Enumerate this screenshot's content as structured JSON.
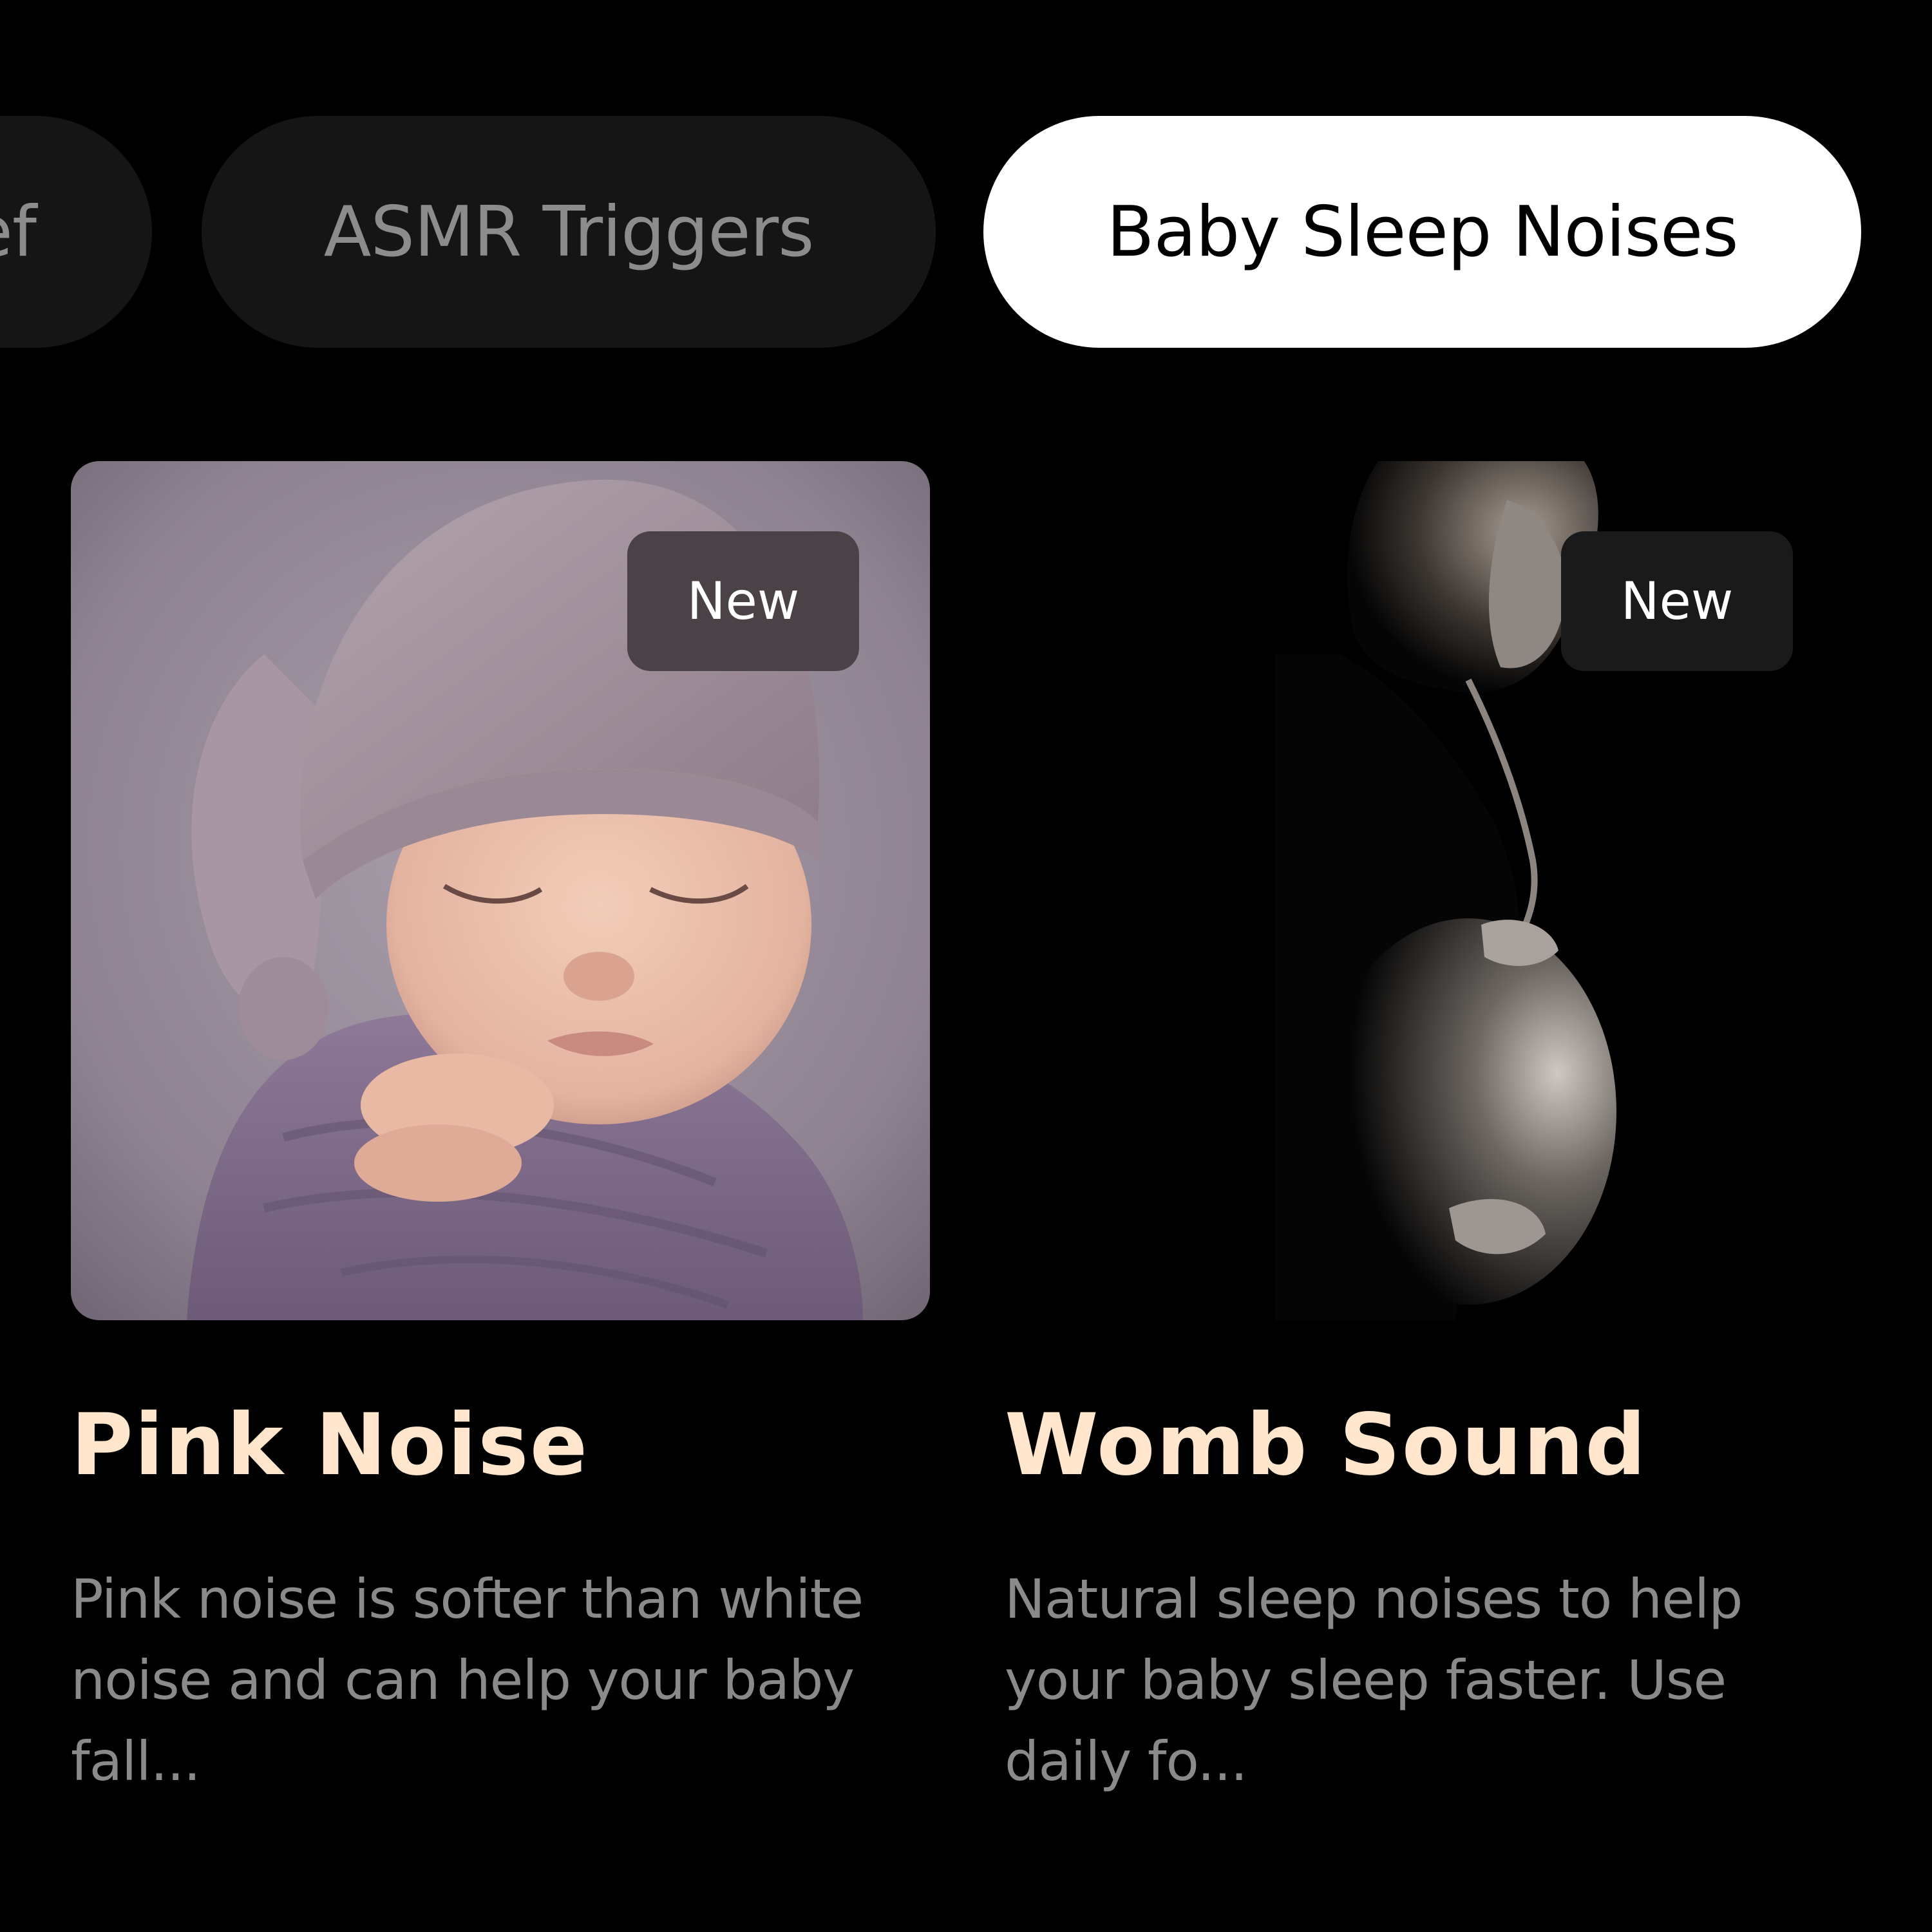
{
  "categories": {
    "items": [
      {
        "label": "ef",
        "selected": false
      },
      {
        "label": "ASMR Triggers",
        "selected": false
      },
      {
        "label": "Baby Sleep Noises",
        "selected": true
      }
    ]
  },
  "cards": [
    {
      "title": "Pink Noise",
      "badge": "New",
      "description": "Pink noise is softer than white noise and can help your baby fall...",
      "image_subject": "sleeping baby in knitted hat and purple swaddle"
    },
    {
      "title": "Womb Sound",
      "badge": "New",
      "description": "Natural sleep noises to help your baby sleep faster. Use daily fo...",
      "image_subject": "pregnant woman silhouette on black background"
    }
  ],
  "colors": {
    "background": "#000000",
    "chip_inactive_bg": "#151515",
    "chip_inactive_text": "#8c8c8c",
    "chip_active_bg": "#ffffff",
    "chip_active_text": "#000000",
    "title": "#ffe6cc",
    "description": "#8a8a8a"
  }
}
